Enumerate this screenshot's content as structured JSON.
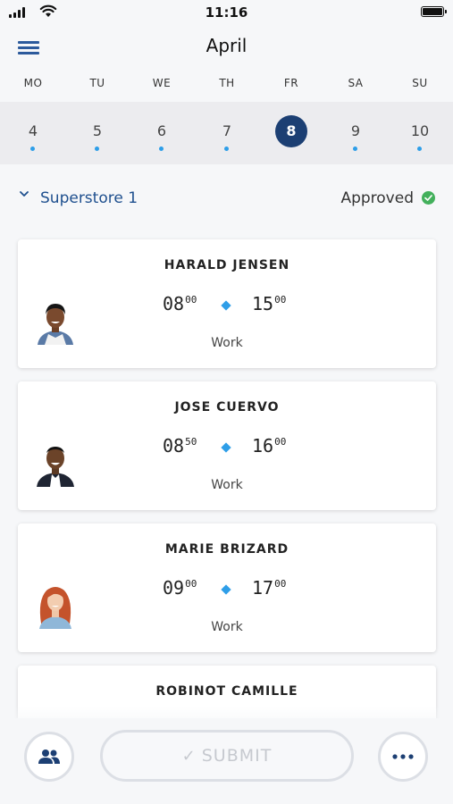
{
  "status_bar": {
    "time": "11:16"
  },
  "header": {
    "month": "April"
  },
  "week": {
    "days": [
      {
        "weekday": "MO",
        "date": "4",
        "has_shift": true,
        "selected": false
      },
      {
        "weekday": "TU",
        "date": "5",
        "has_shift": true,
        "selected": false
      },
      {
        "weekday": "WE",
        "date": "6",
        "has_shift": true,
        "selected": false
      },
      {
        "weekday": "TH",
        "date": "7",
        "has_shift": true,
        "selected": false
      },
      {
        "weekday": "FR",
        "date": "8",
        "has_shift": false,
        "selected": true
      },
      {
        "weekday": "SA",
        "date": "9",
        "has_shift": true,
        "selected": false
      },
      {
        "weekday": "SU",
        "date": "10",
        "has_shift": true,
        "selected": false
      }
    ]
  },
  "store": {
    "name": "Superstore 1",
    "status": "Approved"
  },
  "shifts": [
    {
      "name": "HARALD JENSEN",
      "start_h": "08",
      "start_m": "00",
      "end_h": "15",
      "end_m": "00",
      "type": "Work"
    },
    {
      "name": "JOSE CUERVO",
      "start_h": "08",
      "start_m": "50",
      "end_h": "16",
      "end_m": "00",
      "type": "Work"
    },
    {
      "name": "MARIE BRIZARD",
      "start_h": "09",
      "start_m": "00",
      "end_h": "17",
      "end_m": "00",
      "type": "Work"
    },
    {
      "name": "ROBINOT CAMILLE",
      "start_h": "",
      "start_m": "",
      "end_h": "",
      "end_m": "",
      "type": ""
    }
  ],
  "actions": {
    "submit_label": "SUBMIT"
  },
  "colors": {
    "primary": "#1c3f73",
    "accent": "#2e9ee8",
    "link": "#1e4f8e",
    "approved": "#43b05c"
  }
}
